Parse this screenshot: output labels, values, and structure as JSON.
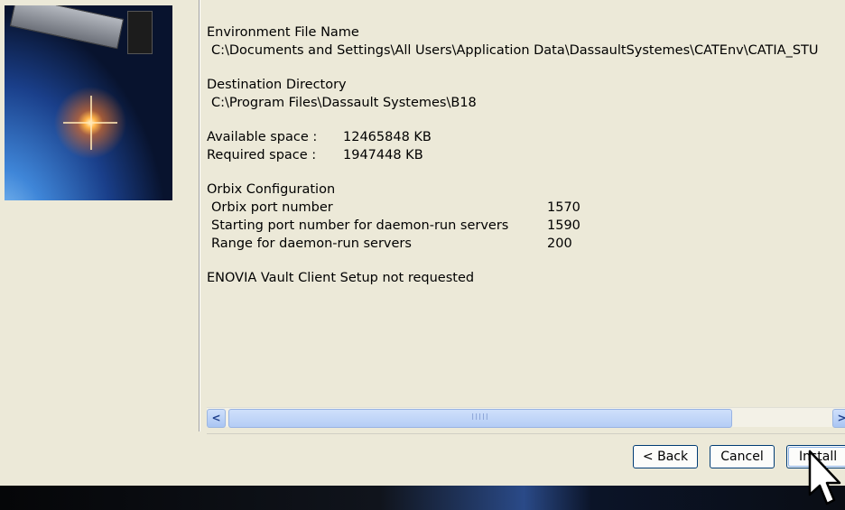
{
  "summary": {
    "env_file_heading": "Environment File Name",
    "env_file_path": "C:\\Documents and Settings\\All Users\\Application Data\\DassaultSystemes\\CATEnv\\CATIA_STU",
    "dest_dir_heading": "Destination Directory",
    "dest_dir_path": "C:\\Program Files\\Dassault Systemes\\B18",
    "available_space_label": "Available space :",
    "available_space_value": "12465848 KB",
    "required_space_label": "Required space  :",
    "required_space_value": "1947448 KB",
    "orbix_heading": "Orbix Configuration",
    "orbix_rows": [
      {
        "label": "Orbix port number",
        "value": "1570"
      },
      {
        "label": "Starting port number for daemon-run servers",
        "value": "1590"
      },
      {
        "label": "Range for daemon-run servers",
        "value": "200"
      }
    ],
    "vault_note": "ENOVIA Vault Client Setup not requested"
  },
  "scrollbar": {
    "left_arrow": "<",
    "right_arrow": ">",
    "thumb_grip": "IIIII"
  },
  "buttons": {
    "back": "< Back",
    "cancel": "Cancel",
    "install": "Install"
  },
  "icons": {
    "cursor": "pointer-cursor-icon"
  }
}
